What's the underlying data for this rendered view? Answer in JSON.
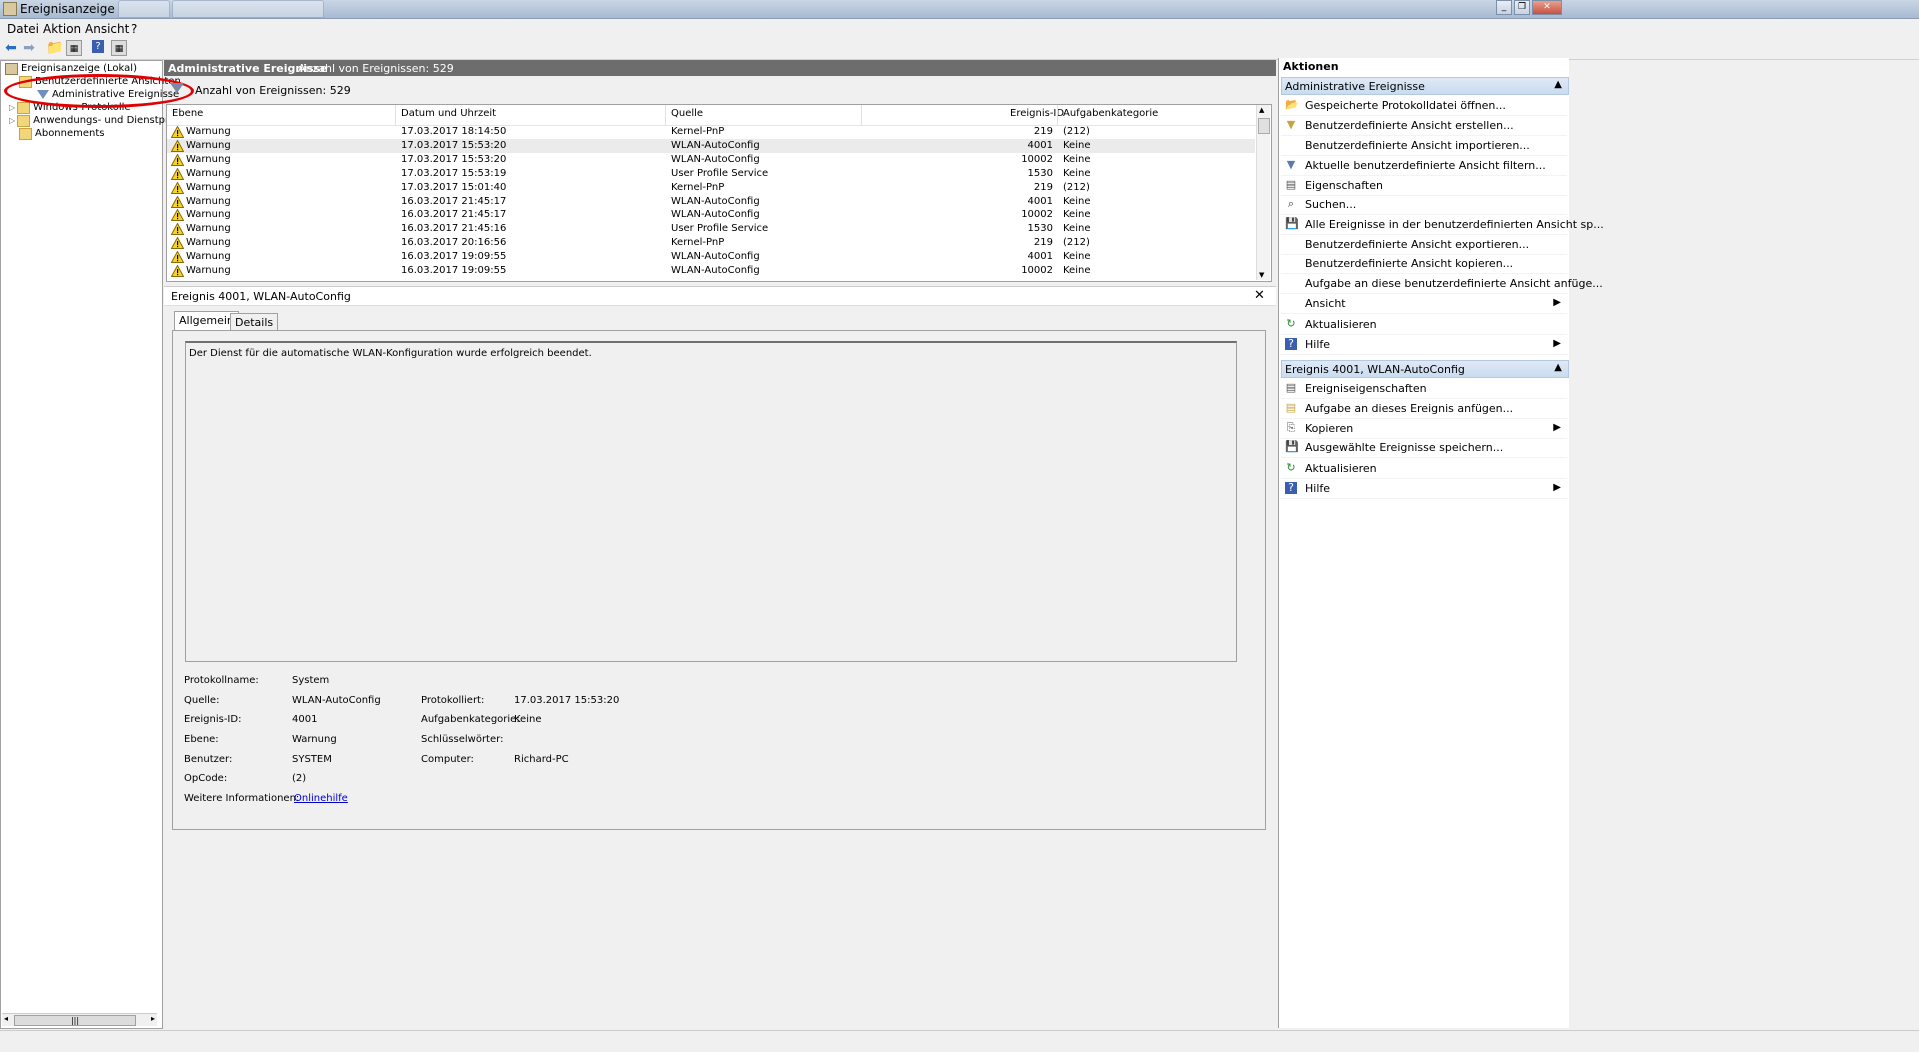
{
  "window": {
    "title": "Ereignisanzeige"
  },
  "menu": [
    "Datei",
    "Aktion",
    "Ansicht",
    "?"
  ],
  "tree": {
    "root": "Ereignisanzeige (Lokal)",
    "custom_views": "Benutzerdefinierte Ansichten",
    "admin_events": "Administrative Ereignisse",
    "windows_logs": "Windows-Protokolle",
    "app_service_logs": "Anwendungs- und Dienstprotok",
    "subscriptions": "Abonnements"
  },
  "center": {
    "header_title": "Administrative Ereignisse",
    "header_count": "Anzahl von Ereignissen: 529",
    "filter_count": "Anzahl von Ereignissen: 529",
    "columns": [
      "Ebene",
      "Datum und Uhrzeit",
      "Quelle",
      "Ereignis-ID",
      "Aufgabenkategorie"
    ],
    "rows": [
      {
        "level": "Warnung",
        "date": "17.03.2017 18:14:50",
        "source": "Kernel-PnP",
        "id": "219",
        "category": "(212)"
      },
      {
        "level": "Warnung",
        "date": "17.03.2017 15:53:20",
        "source": "WLAN-AutoConfig",
        "id": "4001",
        "category": "Keine"
      },
      {
        "level": "Warnung",
        "date": "17.03.2017 15:53:20",
        "source": "WLAN-AutoConfig",
        "id": "10002",
        "category": "Keine"
      },
      {
        "level": "Warnung",
        "date": "17.03.2017 15:53:19",
        "source": "User Profile Service",
        "id": "1530",
        "category": "Keine"
      },
      {
        "level": "Warnung",
        "date": "17.03.2017 15:01:40",
        "source": "Kernel-PnP",
        "id": "219",
        "category": "(212)"
      },
      {
        "level": "Warnung",
        "date": "16.03.2017 21:45:17",
        "source": "WLAN-AutoConfig",
        "id": "4001",
        "category": "Keine"
      },
      {
        "level": "Warnung",
        "date": "16.03.2017 21:45:17",
        "source": "WLAN-AutoConfig",
        "id": "10002",
        "category": "Keine"
      },
      {
        "level": "Warnung",
        "date": "16.03.2017 21:45:16",
        "source": "User Profile Service",
        "id": "1530",
        "category": "Keine"
      },
      {
        "level": "Warnung",
        "date": "16.03.2017 20:16:56",
        "source": "Kernel-PnP",
        "id": "219",
        "category": "(212)"
      },
      {
        "level": "Warnung",
        "date": "16.03.2017 19:09:55",
        "source": "WLAN-AutoConfig",
        "id": "4001",
        "category": "Keine"
      },
      {
        "level": "Warnung",
        "date": "16.03.2017 19:09:55",
        "source": "WLAN-AutoConfig",
        "id": "10002",
        "category": "Keine"
      }
    ]
  },
  "detail": {
    "title": "Ereignis 4001, WLAN-AutoConfig",
    "tab_general": "Allgemein",
    "tab_details": "Details",
    "description": "Der Dienst für die automatische WLAN-Konfiguration wurde erfolgreich beendet.",
    "labels": {
      "log_name": "Protokollname:",
      "source": "Quelle:",
      "event_id": "Ereignis-ID:",
      "level": "Ebene:",
      "user": "Benutzer:",
      "opcode": "OpCode:",
      "more_info": "Weitere Informationen:",
      "logged": "Protokolliert:",
      "task_category": "Aufgabenkategorie:",
      "keywords": "Schlüsselwörter:",
      "computer": "Computer:"
    },
    "values": {
      "log_name": "System",
      "source": "WLAN-AutoConfig",
      "event_id": "4001",
      "level": "Warnung",
      "user": "SYSTEM",
      "opcode": "(2)",
      "more_info": "Onlinehilfe",
      "logged": "17.03.2017 15:53:20",
      "task_category": "Keine",
      "computer": "Richard-PC"
    }
  },
  "actions": {
    "title": "Aktionen",
    "section1": "Administrative Ereignisse",
    "items1": [
      "Gespeicherte Protokolldatei öffnen...",
      "Benutzerdefinierte Ansicht erstellen...",
      "Benutzerdefinierte Ansicht importieren...",
      "Aktuelle benutzerdefinierte Ansicht filtern...",
      "Eigenschaften",
      "Suchen...",
      "Alle Ereignisse in der benutzerdefinierten Ansicht sp...",
      "Benutzerdefinierte Ansicht exportieren...",
      "Benutzerdefinierte Ansicht kopieren...",
      "Aufgabe an diese benutzerdefinierte Ansicht anfüge...",
      "Ansicht",
      "Aktualisieren",
      "Hilfe"
    ],
    "section2": "Ereignis 4001, WLAN-AutoConfig",
    "items2": [
      "Ereigniseigenschaften",
      "Aufgabe an dieses Ereignis anfügen...",
      "Kopieren",
      "Ausgewählte Ereignisse speichern...",
      "Aktualisieren",
      "Hilfe"
    ]
  },
  "colors": {
    "header_bg": "#6d6d6d",
    "section_bg": "#c9dcf0",
    "annotation": "#e00000",
    "link": "#0000cc"
  }
}
